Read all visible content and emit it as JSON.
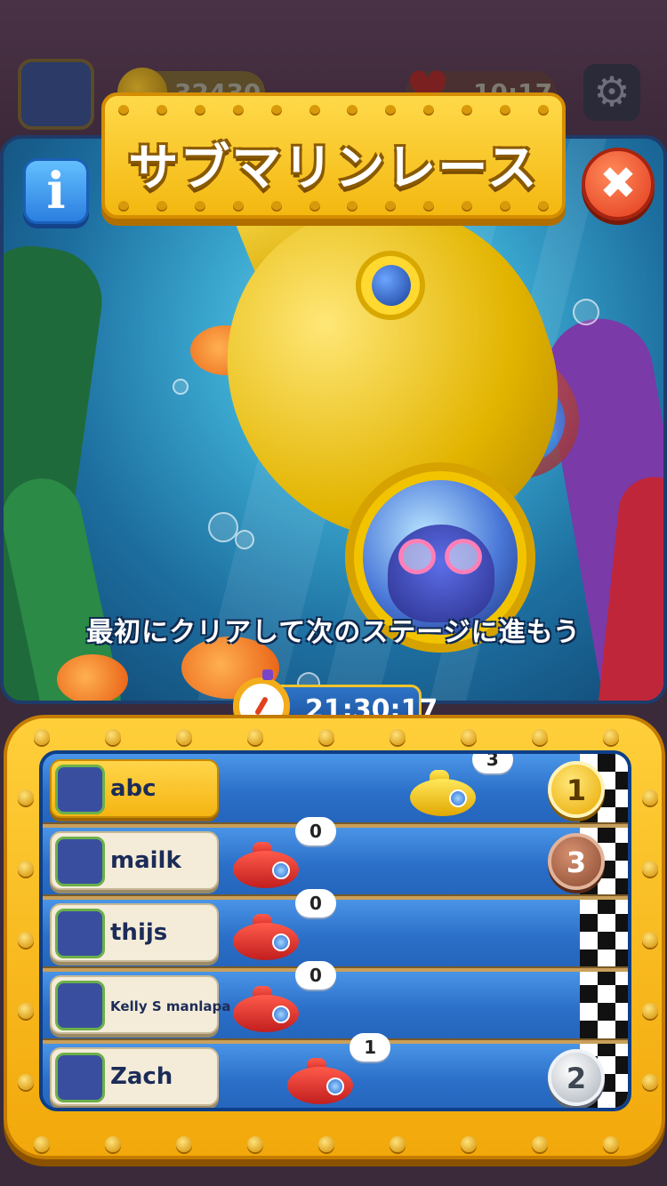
{
  "hud": {
    "coins": "32430",
    "lives_timer": "10:17",
    "icons": {
      "coin": "coin-icon",
      "heart": "heart-icon",
      "settings": "gear-icon"
    }
  },
  "event": {
    "title": "サブマリンレース",
    "subtitle": "最初にクリアして次のステージに進もう",
    "timer": "21:30:17"
  },
  "buttons": {
    "info": "i",
    "close": "✖"
  },
  "race": {
    "players": [
      {
        "name": "abc",
        "score": "3",
        "rank": "1",
        "medal": "gold",
        "is_me": true,
        "sub_color": "yellow",
        "progress": 0.65
      },
      {
        "name": "mailk",
        "score": "0",
        "rank": "3",
        "medal": "bronze",
        "is_me": false,
        "sub_color": "red",
        "progress": 0.0
      },
      {
        "name": "thijs",
        "score": "0",
        "rank": "",
        "medal": "",
        "is_me": false,
        "sub_color": "red",
        "progress": 0.0
      },
      {
        "name": "Kelly S manlapa",
        "score": "0",
        "rank": "",
        "medal": "",
        "is_me": false,
        "sub_color": "red",
        "progress": 0.0
      },
      {
        "name": "Zach",
        "score": "1",
        "rank": "2",
        "medal": "silver",
        "is_me": false,
        "sub_color": "red",
        "progress": 0.2
      }
    ]
  }
}
